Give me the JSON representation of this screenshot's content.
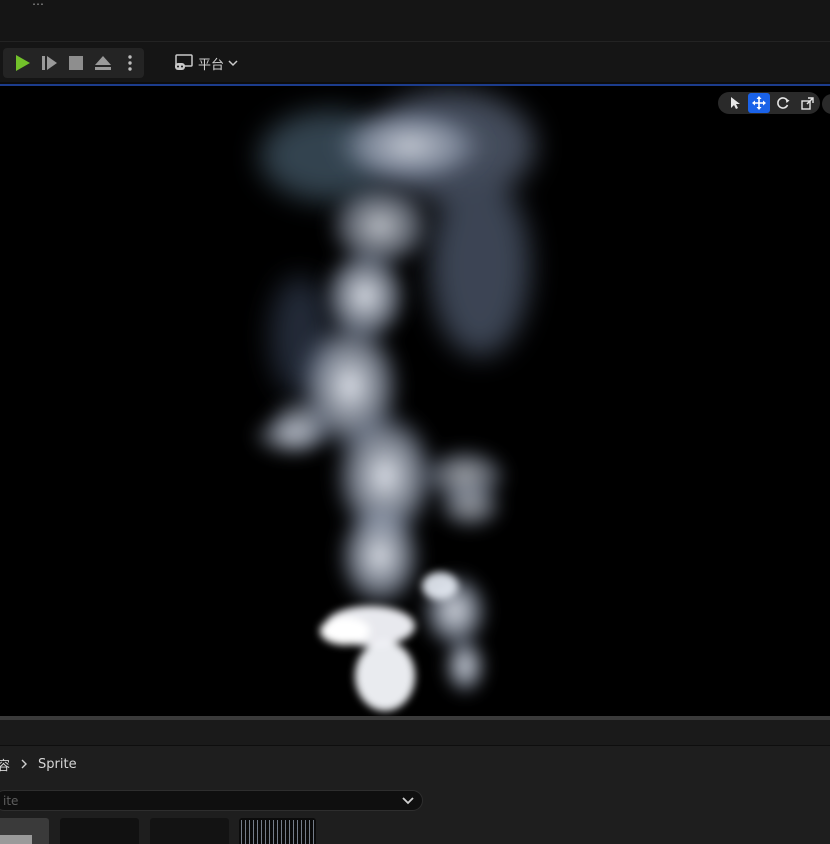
{
  "top_bar": {
    "menu_text": "…"
  },
  "toolbar": {
    "play_label": "Play",
    "resume_label": "Advance Frame",
    "stop_label": "Stop",
    "eject_label": "Eject",
    "more_label": "More",
    "platform_label": "平台"
  },
  "viewport": {
    "tools": [
      "select-icon",
      "move-icon",
      "rotate-icon",
      "scale-icon"
    ],
    "active_tool": "move-icon",
    "accent_color": "#1a62e8"
  },
  "content_browser": {
    "breadcrumb": {
      "root": "容",
      "items": [
        "Sprite"
      ]
    },
    "search": {
      "placeholder": "ite"
    },
    "assets": [
      "",
      "",
      "",
      ""
    ]
  },
  "colors": {
    "background": "#151515",
    "viewport": "#000000",
    "play_green": "#72c12a",
    "accent_blue": "#1c3c8c"
  }
}
